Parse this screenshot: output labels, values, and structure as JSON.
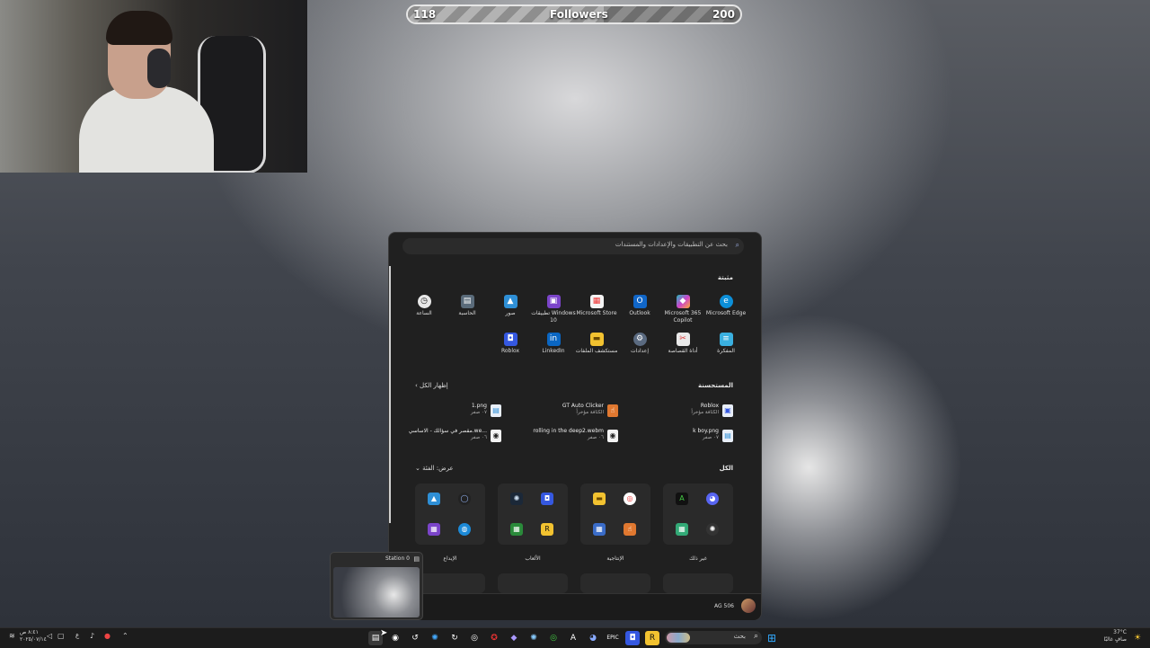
{
  "followers": {
    "current": "118",
    "label": "Followers",
    "goal": "200",
    "progress": 0.59
  },
  "startmenu": {
    "search_placeholder": "بحث عن التطبيقات والإعدادات والمستندات",
    "pinned_title": "مثبتة",
    "pinned": [
      {
        "label": "Microsoft Edge",
        "icon": "edge-icon"
      },
      {
        "label": "Microsoft 365 Copilot",
        "icon": "copilot-icon"
      },
      {
        "label": "Outlook",
        "icon": "outlook-icon"
      },
      {
        "label": "Microsoft Store",
        "icon": "store-icon"
      },
      {
        "label": "تطبيقات Windows 10",
        "icon": "apps-icon"
      },
      {
        "label": "صور",
        "icon": "photos-icon"
      },
      {
        "label": "الحاسبة",
        "icon": "calculator-icon"
      },
      {
        "label": "الساعة",
        "icon": "clock-icon"
      },
      {
        "label": "المفكرة",
        "icon": "notepad-icon"
      },
      {
        "label": "أداة القصاصة",
        "icon": "snipping-tool-icon"
      },
      {
        "label": "إعدادات",
        "icon": "settings-icon"
      },
      {
        "label": "مستكشف الملفات",
        "icon": "file-explorer-icon"
      },
      {
        "label": "LinkedIn",
        "icon": "linkedin-icon"
      },
      {
        "label": "Roblox",
        "icon": "roblox-icon"
      }
    ],
    "recommended_title": "المستحسنة",
    "show_all": "إظهار الكل",
    "recommended": [
      {
        "name": "Roblox",
        "sub": "الكثافة مؤخراً"
      },
      {
        "name": "GT Auto Clicker",
        "sub": "الكثافة مؤخراً"
      },
      {
        "name": "1.png",
        "sub": "٠٧ صفر"
      },
      {
        "name": "k boy.png",
        "sub": "٠٧ صفر"
      },
      {
        "name": "rolling in the deep2.webm",
        "sub": "٠٦ صفر"
      },
      {
        "name": "مقصر في سؤالك - الاساسي.we...",
        "sub": "٠٦ صفر"
      }
    ],
    "all_title": "الكل",
    "view_by": "عرض: الفئة",
    "categories": [
      {
        "label": "غير ذلك"
      },
      {
        "label": "الإنتاجية"
      },
      {
        "label": "الألعاب"
      },
      {
        "label": "الإبداع"
      }
    ],
    "user_name": "AG 506"
  },
  "preview": {
    "title": "Station 0"
  },
  "taskbar": {
    "search_label": "بحث",
    "time": "٨:٤١ ص",
    "date": "٢٠٢٥/٠٧/١٤",
    "weather_temp": "37°C",
    "weather_desc": "صافٍ غالبًا",
    "lang": "ع"
  },
  "colors": {
    "start_bg": "#202020",
    "taskbar_bg": "#1c1c1c",
    "accent": "#0078d4"
  }
}
